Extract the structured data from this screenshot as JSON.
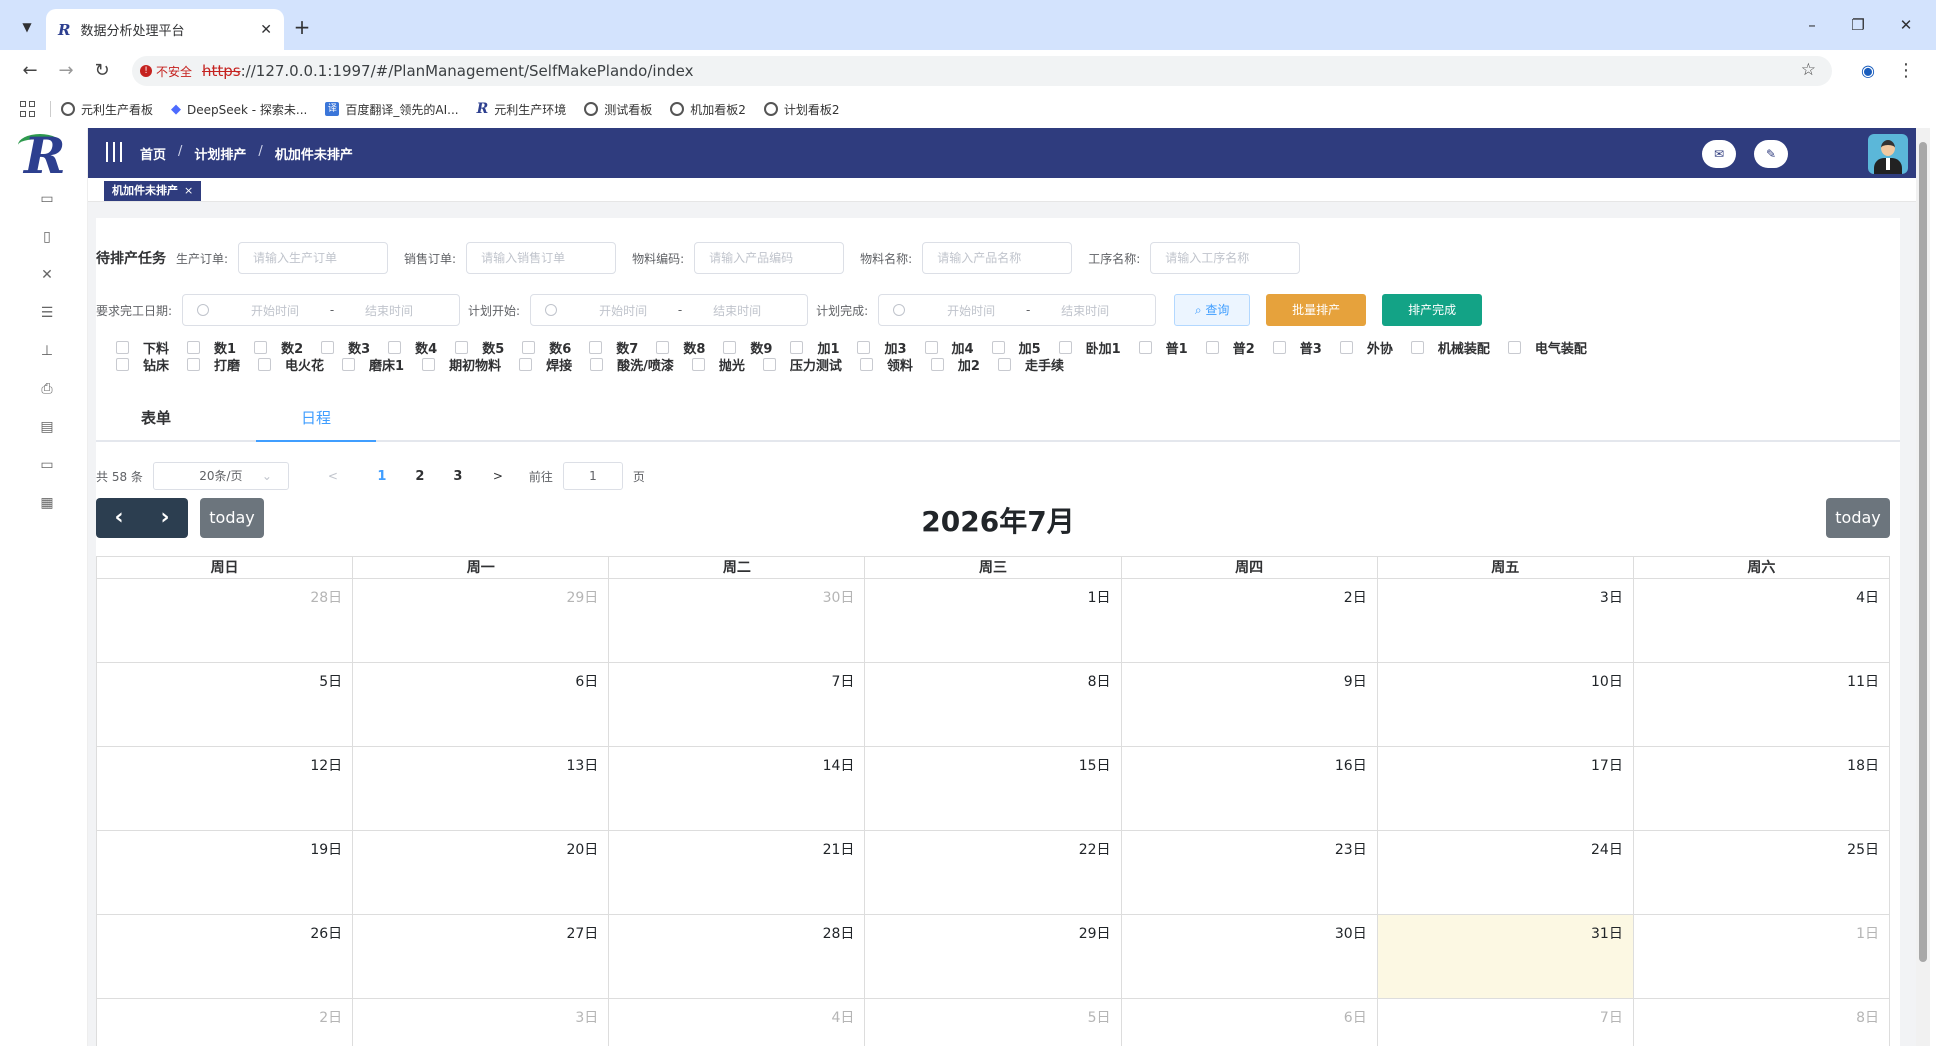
{
  "browser": {
    "tab_title": "数据分析处理平台",
    "tab_favicon": "R",
    "url_insecure_label": "不安全",
    "url_scheme": "https",
    "url_rest": "://127.0.0.1:1997/#/PlanManagement/SelfMakePlando/index",
    "bookmarks": [
      "元利生产看板",
      "DeepSeek - 探索未...",
      "百度翻译_领先的AI...",
      "元利生产环境",
      "测试看板",
      "机加看板2",
      "计划看板2"
    ]
  },
  "header": {
    "breadcrumb": [
      "首页",
      "计划排产",
      "机加件未排产"
    ],
    "tag": "机加件未排产"
  },
  "filters": {
    "title": "待排产任务",
    "fields": [
      {
        "label": "生产订单:",
        "placeholder": "请输入生产订单"
      },
      {
        "label": "销售订单:",
        "placeholder": "请输入销售订单"
      },
      {
        "label": "物料编码:",
        "placeholder": "请输入产品编码"
      },
      {
        "label": "物料名称:",
        "placeholder": "请输入产品名称"
      },
      {
        "label": "工序名称:",
        "placeholder": "请输入工序名称"
      }
    ],
    "date_ranges": [
      {
        "label": "要求完工日期:",
        "start": "开始时间",
        "end": "结束时间"
      },
      {
        "label": "计划开始:",
        "start": "开始时间",
        "end": "结束时间"
      },
      {
        "label": "计划完成:",
        "start": "开始时间",
        "end": "结束时间"
      }
    ],
    "range_sep": "-",
    "buttons": {
      "query": "查询",
      "batch": "批量排产",
      "done": "排产完成"
    }
  },
  "checkboxes": {
    "row1": [
      "下料",
      "数1",
      "数2",
      "数3",
      "数4",
      "数5",
      "数6",
      "数7",
      "数8",
      "数9",
      "加1",
      "加3",
      "加4",
      "加5",
      "卧加1",
      "普1",
      "普2",
      "普3",
      "外协",
      "机械装配",
      "电气装配"
    ],
    "row2": [
      "钻床",
      "打磨",
      "电火花",
      "磨床1",
      "期初物料",
      "焊接",
      "酸洗/喷漆",
      "抛光",
      "压力测试",
      "领料",
      "加2",
      "走手续"
    ]
  },
  "tabs": [
    "表单",
    "日程"
  ],
  "pager": {
    "total": "共 58 条",
    "page_size": "20条/页",
    "pages": [
      "1",
      "2",
      "3"
    ],
    "current": "1",
    "goto_label": "前往",
    "goto_value": "1",
    "page_suffix": "页"
  },
  "calendar": {
    "title": "2026年7月",
    "today_label": "today",
    "weekdays": [
      "周日",
      "周一",
      "周二",
      "周三",
      "周四",
      "周五",
      "周六"
    ],
    "days": [
      {
        "d": "28日",
        "other": true
      },
      {
        "d": "29日",
        "other": true
      },
      {
        "d": "30日",
        "other": true
      },
      {
        "d": "1日"
      },
      {
        "d": "2日"
      },
      {
        "d": "3日"
      },
      {
        "d": "4日"
      },
      {
        "d": "5日"
      },
      {
        "d": "6日"
      },
      {
        "d": "7日"
      },
      {
        "d": "8日"
      },
      {
        "d": "9日"
      },
      {
        "d": "10日"
      },
      {
        "d": "11日"
      },
      {
        "d": "12日"
      },
      {
        "d": "13日"
      },
      {
        "d": "14日"
      },
      {
        "d": "15日"
      },
      {
        "d": "16日"
      },
      {
        "d": "17日"
      },
      {
        "d": "18日"
      },
      {
        "d": "19日"
      },
      {
        "d": "20日"
      },
      {
        "d": "21日"
      },
      {
        "d": "22日"
      },
      {
        "d": "23日"
      },
      {
        "d": "24日"
      },
      {
        "d": "25日"
      },
      {
        "d": "26日"
      },
      {
        "d": "27日"
      },
      {
        "d": "28日"
      },
      {
        "d": "29日"
      },
      {
        "d": "30日"
      },
      {
        "d": "31日",
        "today": true
      },
      {
        "d": "1日",
        "other": true
      },
      {
        "d": "2日",
        "other": true
      },
      {
        "d": "3日",
        "other": true
      },
      {
        "d": "4日",
        "other": true
      },
      {
        "d": "5日",
        "other": true
      },
      {
        "d": "6日",
        "other": true
      },
      {
        "d": "7日",
        "other": true
      },
      {
        "d": "8日",
        "other": true
      }
    ]
  },
  "colors": {
    "brand": "#2f3c7e",
    "accent": "#409eff",
    "batch": "#e6a23c",
    "done": "#13a386",
    "today_bg": "#fcf8e3"
  }
}
